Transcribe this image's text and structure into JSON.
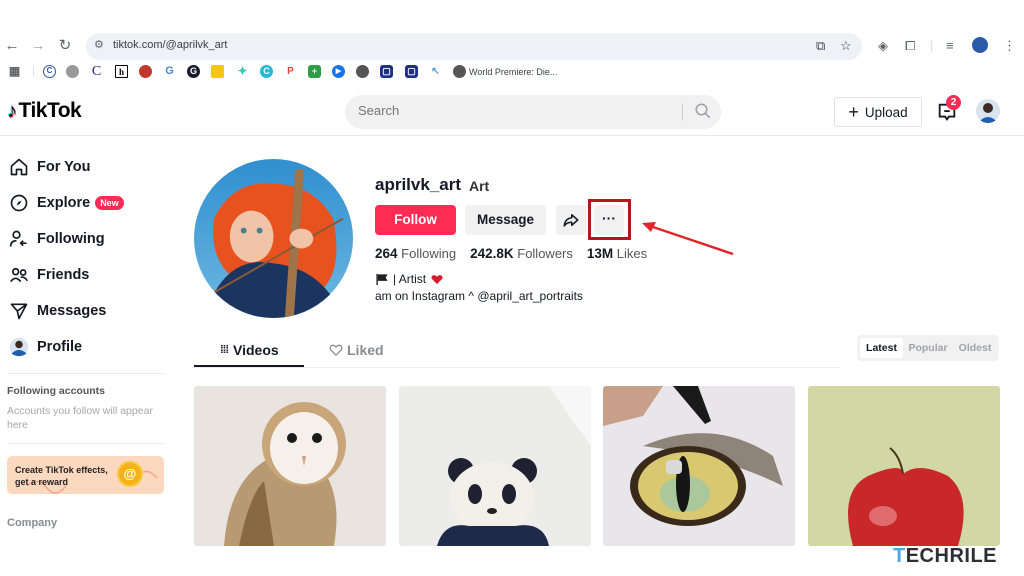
{
  "browser": {
    "url": "tiktok.com/@aprilvk_art",
    "bookmarks": [
      {
        "icon": "apps-grid-icon"
      },
      {
        "icon": "copyright-icon"
      },
      {
        "icon": "gear-badge-icon"
      },
      {
        "icon": "letter-c-icon"
      },
      {
        "icon": "letter-h-icon"
      },
      {
        "icon": "red-circle-icon"
      },
      {
        "icon": "g-logo-icon"
      },
      {
        "icon": "g-dark-icon"
      },
      {
        "icon": "yellow-hat-icon"
      },
      {
        "icon": "sparkle-icon"
      },
      {
        "icon": "canva-icon"
      },
      {
        "icon": "p-icon"
      },
      {
        "icon": "green-plus-icon"
      },
      {
        "icon": "blue-play-icon"
      },
      {
        "icon": "globe-icon"
      },
      {
        "icon": "chat-square-icon"
      },
      {
        "icon": "chat-square-icon-2"
      },
      {
        "icon": "cursor-icon"
      }
    ],
    "bookmark_label": "World Premiere: Die..."
  },
  "header": {
    "logo": "TikTok",
    "search_placeholder": "Search",
    "upload_label": "Upload",
    "inbox_badge": "2"
  },
  "sidebar": {
    "items": [
      {
        "label": "For You",
        "icon": "home-icon"
      },
      {
        "label": "Explore",
        "icon": "compass-icon",
        "badge": "New"
      },
      {
        "label": "Following",
        "icon": "following-icon"
      },
      {
        "label": "Friends",
        "icon": "friends-icon"
      },
      {
        "label": "Messages",
        "icon": "send-icon"
      },
      {
        "label": "Profile",
        "icon": "avatar"
      }
    ],
    "following_heading": "Following accounts",
    "following_sub": "Accounts you follow will appear here",
    "effects_card": "Create TikTok effects, get a reward",
    "company": "Company"
  },
  "profile": {
    "username": "aprilvk_art",
    "nickname": "Art",
    "follow_label": "Follow",
    "message_label": "Message",
    "more_label": "···",
    "stats": [
      {
        "value": "264",
        "label": "Following"
      },
      {
        "value": "242.8K",
        "label": "Followers"
      },
      {
        "value": "13M",
        "label": "Likes"
      }
    ],
    "bio_line1": "| Artist",
    "bio_line2": "am on Instagram ^ @april_art_portraits"
  },
  "tabs": {
    "videos": "Videos",
    "liked": "Liked"
  },
  "sort": {
    "options": [
      "Latest",
      "Popular",
      "Oldest"
    ],
    "selected": "Latest"
  },
  "videos": [
    {
      "subject": "owl painting"
    },
    {
      "subject": "panda painting"
    },
    {
      "subject": "cat eye drawing"
    },
    {
      "subject": "apple painting"
    }
  ],
  "watermark": {
    "first": "T",
    "rest": "ECHRILE"
  }
}
